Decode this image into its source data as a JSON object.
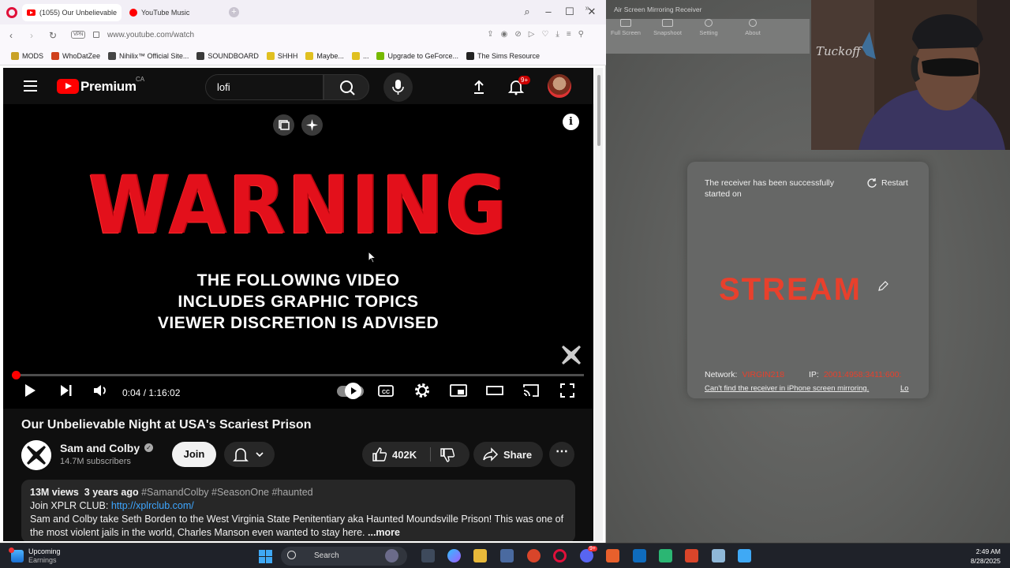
{
  "browser": {
    "tabs": [
      {
        "label": "(1055) Our Unbelievable",
        "active": true
      },
      {
        "label": "YouTube Music",
        "active": false
      }
    ],
    "url": "www.youtube.com/watch",
    "vpn_label": "VPN",
    "bookmarks": [
      {
        "label": "MODS",
        "color": "#c9a227"
      },
      {
        "label": "WhoDatZee",
        "color": "#d0401c"
      },
      {
        "label": "Nihilix™ Official Site...",
        "color": "#444444"
      },
      {
        "label": "SOUNDBOARD",
        "color": "#3a3a3a"
      },
      {
        "label": "SHHH",
        "color": "#e0c020"
      },
      {
        "label": "Maybe...",
        "color": "#e0c020"
      },
      {
        "label": "...",
        "color": "#e0c020"
      },
      {
        "label": "Upgrade to GeForce...",
        "color": "#76b900"
      },
      {
        "label": "The Sims Resource",
        "color": "#222222"
      }
    ],
    "bookmarks_more": "»"
  },
  "youtube": {
    "brand": "Premium",
    "region": "CA",
    "search_value": "lofi",
    "notif_badge": "9+",
    "player": {
      "warning": "WARNING",
      "subtext": [
        "THE FOLLOWING VIDEO",
        "INCLUDES GRAPHIC TOPICS",
        "VIEWER DISCRETION IS ADVISED"
      ],
      "time": "0:04 / 1:16:02",
      "progress_fraction": 0.0009
    },
    "video": {
      "title": "Our Unbelievable Night at USA's Scariest Prison",
      "channel": "Sam and Colby",
      "subscribers": "14.7M subscribers",
      "join_label": "Join",
      "likes": "402K",
      "share_label": "Share",
      "more_label": "⋯"
    },
    "description": {
      "views": "13M views",
      "age": "3 years ago",
      "tags": "#SamandColby #SeasonOne #haunted",
      "club_prefix": "Join XPLR CLUB: ",
      "club_link": "http://xplrclub.com/",
      "body": "Sam and Colby take Seth Borden to the West Virginia State Penitentiary aka Haunted Moundsville Prison! This was one of the most violent jails in the world, Charles Manson even wanted to stay here.",
      "more": "...more"
    }
  },
  "receiver": {
    "title": "Air Screen Mirroring Receiver",
    "toolbar": [
      {
        "label": "Full Screen",
        "icon": "fullscreen-icon"
      },
      {
        "label": "Snapshoot",
        "icon": "camera-icon"
      },
      {
        "label": "Setting",
        "icon": "gear-icon"
      },
      {
        "label": "About",
        "icon": "info-icon"
      }
    ],
    "message": "The receiver has been successfully started on",
    "restart_label": "Restart",
    "device_name": "STREAM",
    "network_label": "Network:",
    "network_value": "VIRGIN218",
    "ip_label": "IP:",
    "ip_value": "2001:4958:3411:600:",
    "cant_find": "Can't find the receiver in iPhone screen mirroring.",
    "cant_find_more": "Lo"
  },
  "taskbar": {
    "widget_title": "Upcoming",
    "widget_sub": "Earnings",
    "search_placeholder": "Search",
    "time": "2:49 AM",
    "date": "8/28/2025",
    "discord_badge": "9+"
  }
}
